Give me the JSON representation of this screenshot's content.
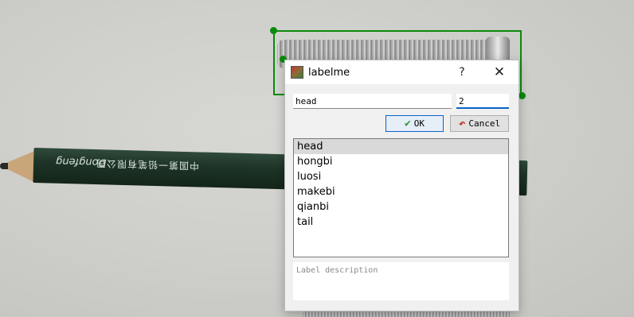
{
  "dialog": {
    "title": "labelme",
    "help_label": "?",
    "close_label": "✕",
    "label_input_value": "head",
    "group_id_value": "2",
    "ok_label": "OK",
    "cancel_label": "Cancel",
    "labels": [
      "head",
      "hongbi",
      "luosi",
      "makebi",
      "qianbi",
      "tail"
    ],
    "selected_index": 0,
    "description_placeholder": "Label description"
  },
  "scene": {
    "pencil_brand": "Dongfeng",
    "pencil_text": "中国第一铅笔有限公司"
  },
  "colors": {
    "bbox": "#0a8a0a",
    "accent": "#0a64c8"
  },
  "icons": {
    "ok": "check-icon",
    "cancel": "undo-icon",
    "app": "labelme-icon"
  }
}
